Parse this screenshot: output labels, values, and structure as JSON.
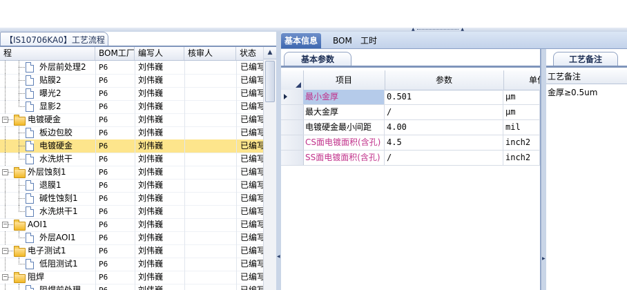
{
  "left_panel": {
    "title": "【IS10706KA0】工艺流程",
    "columns": [
      "程",
      "BOM工厂",
      "编写人",
      "核审人",
      "状态"
    ],
    "rows": [
      {
        "name": "外层前处理2",
        "factory": "P6",
        "author": "刘伟巍",
        "reviewer": "",
        "status": "已编写",
        "type": "item"
      },
      {
        "name": "贴膜2",
        "factory": "P6",
        "author": "刘伟巍",
        "reviewer": "",
        "status": "已编写",
        "type": "item"
      },
      {
        "name": "曝光2",
        "factory": "P6",
        "author": "刘伟巍",
        "reviewer": "",
        "status": "已编写",
        "type": "item"
      },
      {
        "name": "显影2",
        "factory": "P6",
        "author": "刘伟巍",
        "reviewer": "",
        "status": "已编写",
        "type": "item"
      },
      {
        "name": "电镀硬金",
        "factory": "P6",
        "author": "刘伟巍",
        "reviewer": "",
        "status": "已编写",
        "type": "folder"
      },
      {
        "name": "板边包胶",
        "factory": "P6",
        "author": "刘伟巍",
        "reviewer": "",
        "status": "已编写",
        "type": "item"
      },
      {
        "name": "电镀硬金",
        "factory": "P6",
        "author": "刘伟巍",
        "reviewer": "",
        "status": "已编写",
        "type": "item",
        "selected": true
      },
      {
        "name": "水洗烘干",
        "factory": "P6",
        "author": "刘伟巍",
        "reviewer": "",
        "status": "已编写",
        "type": "item"
      },
      {
        "name": "外层蚀刻1",
        "factory": "P6",
        "author": "刘伟巍",
        "reviewer": "",
        "status": "已编写",
        "type": "folder"
      },
      {
        "name": "退膜1",
        "factory": "P6",
        "author": "刘伟巍",
        "reviewer": "",
        "status": "已编写",
        "type": "item"
      },
      {
        "name": "碱性蚀刻1",
        "factory": "P6",
        "author": "刘伟巍",
        "reviewer": "",
        "status": "已编写",
        "type": "item"
      },
      {
        "name": "水洗烘干1",
        "factory": "P6",
        "author": "刘伟巍",
        "reviewer": "",
        "status": "已编写",
        "type": "item"
      },
      {
        "name": "AOI1",
        "factory": "P6",
        "author": "刘伟巍",
        "reviewer": "",
        "status": "已编写",
        "type": "folder"
      },
      {
        "name": "外层AOI1",
        "factory": "P6",
        "author": "刘伟巍",
        "reviewer": "",
        "status": "已编写",
        "type": "item"
      },
      {
        "name": "电子测试1",
        "factory": "P6",
        "author": "刘伟巍",
        "reviewer": "",
        "status": "已编写",
        "type": "folder"
      },
      {
        "name": "低阻测试1",
        "factory": "P6",
        "author": "刘伟巍",
        "reviewer": "",
        "status": "已编写",
        "type": "item"
      },
      {
        "name": "阻焊",
        "factory": "P6",
        "author": "刘伟巍",
        "reviewer": "",
        "status": "已编写",
        "type": "folder"
      },
      {
        "name": "阻焊前处理",
        "factory": "P6",
        "author": "刘伟巍",
        "reviewer": "",
        "status": "已编写",
        "type": "item"
      }
    ]
  },
  "tabs": [
    "基本信息",
    "BOM",
    "工时"
  ],
  "active_tab": 0,
  "params_panel": {
    "tab_label": "基本参数",
    "columns": [
      "项目",
      "参数",
      "单位"
    ],
    "rows": [
      {
        "item": "最小金厚",
        "value": "0.501",
        "unit": "μm",
        "highlight": true,
        "current": true
      },
      {
        "item": "最大金厚",
        "value": "/",
        "unit": "μm",
        "highlight": false,
        "current": false
      },
      {
        "item": "电镀硬金最小间距",
        "value": "4.00",
        "unit": "mil",
        "highlight": false,
        "current": false
      },
      {
        "item": "CS面电镀面积(含孔)",
        "value": "4.5",
        "unit": "inch2",
        "highlight": true,
        "current": false
      },
      {
        "item": "SS面电镀面积(含孔)",
        "value": "/",
        "unit": "inch2",
        "highlight": true,
        "current": false
      }
    ]
  },
  "remarks_panel": {
    "tab_label": "工艺备注",
    "column_label": "工艺备注",
    "value": "金厚≥0.5um"
  },
  "colors": {
    "selected_row": "#fde58c",
    "highlight_text": "#c0308a",
    "active_tab": "#4a72b8"
  },
  "icons": [
    "folder-icon",
    "document-icon",
    "row-indicator-icon",
    "scroll-up-icon"
  ]
}
